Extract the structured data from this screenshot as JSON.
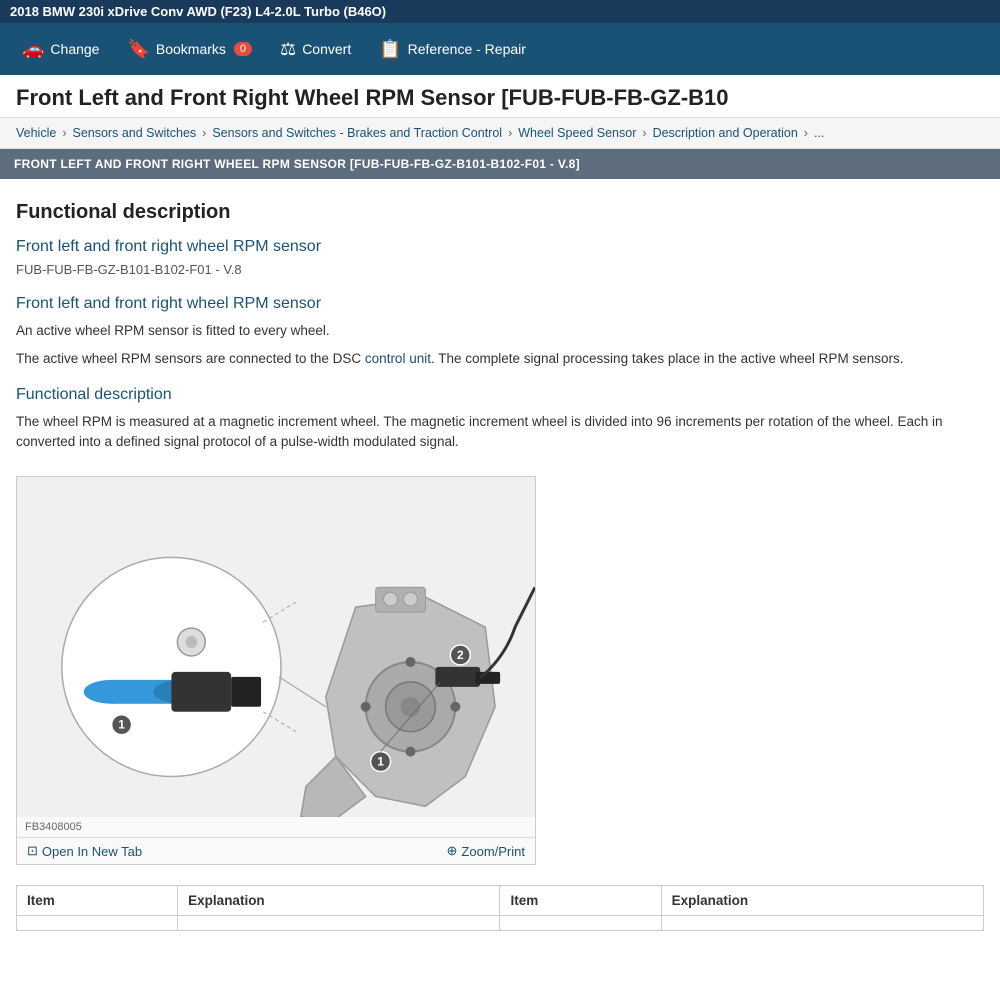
{
  "topbar": {
    "title": "2018 BMW 230i xDrive Conv AWD (F23) L4-2.0L Turbo (B46O)"
  },
  "navbar": {
    "items": [
      {
        "id": "change",
        "label": "Change",
        "icon": "🚗"
      },
      {
        "id": "bookmarks",
        "label": "Bookmarks",
        "icon": "🔖",
        "badge": "0"
      },
      {
        "id": "convert",
        "label": "Convert",
        "icon": "⚖"
      },
      {
        "id": "reference-repair",
        "label": "Reference - Repair",
        "icon": "📋"
      }
    ]
  },
  "page_title": "Front Left and Front Right Wheel RPM Sensor [FUB-FUB-FB-GZ-B10",
  "breadcrumb": {
    "items": [
      {
        "label": "Vehicle",
        "link": true
      },
      {
        "label": "Sensors and Switches",
        "link": true
      },
      {
        "label": "Sensors and Switches - Brakes and Traction Control",
        "link": true
      },
      {
        "label": "Wheel Speed Sensor",
        "link": true
      },
      {
        "label": "Description and Operation",
        "link": true
      },
      {
        "label": "...",
        "link": true
      }
    ]
  },
  "section_header": "FRONT LEFT AND FRONT RIGHT WHEEL RPM SENSOR [FUB-FUB-FB-GZ-B101-B102-F01 - V.8]",
  "main": {
    "functional_heading": "Functional description",
    "link1": "Front left and front right wheel RPM sensor",
    "subtitle": "FUB-FUB-FB-GZ-B101-B102-F01 - V.8",
    "link2": "Front left and front right wheel RPM sensor",
    "body1": "An active wheel RPM sensor is fitted to every wheel.",
    "body2_part1": "The active wheel RPM sensors are connected to the DSC ",
    "body2_link": "control unit",
    "body2_part2": ". The complete signal processing takes place in the active wheel RPM sensors.",
    "functional_heading2": "Functional description",
    "long_text": "The wheel RPM is measured at a magnetic increment wheel. The magnetic increment wheel is divided into 96 increments per rotation of the wheel. Each in converted into a defined signal protocol of a pulse-width modulated signal.",
    "image_caption": "FB3408005",
    "open_new_tab": "Open In New Tab",
    "zoom_print": "Zoom/Print",
    "table": {
      "headers": [
        "Item",
        "Explanation",
        "Item",
        "Explanation"
      ],
      "rows": []
    }
  }
}
